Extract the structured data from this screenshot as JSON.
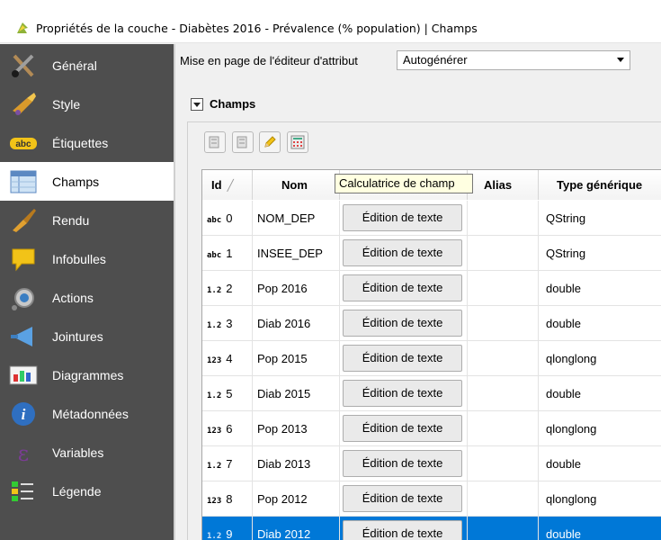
{
  "window": {
    "title": "Propriétés de la couche - Diabètes 2016 - Prévalence (% population) | Champs"
  },
  "sidebar": {
    "items": [
      {
        "label": "Général",
        "icon": "general-tools-icon"
      },
      {
        "label": "Style",
        "icon": "style-brush-icon"
      },
      {
        "label": "Étiquettes",
        "icon": "labels-abc-icon"
      },
      {
        "label": "Champs",
        "icon": "fields-table-icon"
      },
      {
        "label": "Rendu",
        "icon": "rendering-brush-icon"
      },
      {
        "label": "Infobulles",
        "icon": "tooltip-bubble-icon"
      },
      {
        "label": "Actions",
        "icon": "actions-gear-icon"
      },
      {
        "label": "Jointures",
        "icon": "joins-icon"
      },
      {
        "label": "Diagrammes",
        "icon": "diagrams-icon"
      },
      {
        "label": "Métadonnées",
        "icon": "metadata-info-icon"
      },
      {
        "label": "Variables",
        "icon": "variables-epsilon-icon"
      },
      {
        "label": "Légende",
        "icon": "legend-icon"
      }
    ],
    "active": "Champs"
  },
  "editor": {
    "layout_label": "Mise en page de l'éditeur d'attribut",
    "layout_value": "Autogénérer"
  },
  "group": {
    "title": "Champs"
  },
  "tooltip": {
    "text": "Calculatrice de champ"
  },
  "table": {
    "headers": {
      "id": "Id",
      "nom": "Nom",
      "alias": "Alias",
      "type": "Type générique"
    },
    "rows": [
      {
        "badge": "abc",
        "id": "0",
        "nom": "NOM_DEP",
        "edit": "Édition de texte",
        "alias": "",
        "type": "QString"
      },
      {
        "badge": "abc",
        "id": "1",
        "nom": "INSEE_DEP",
        "edit": "Édition de texte",
        "alias": "",
        "type": "QString"
      },
      {
        "badge": "1.2",
        "id": "2",
        "nom": "Pop 2016",
        "edit": "Édition de texte",
        "alias": "",
        "type": "double"
      },
      {
        "badge": "1.2",
        "id": "3",
        "nom": "Diab 2016",
        "edit": "Édition de texte",
        "alias": "",
        "type": "double"
      },
      {
        "badge": "123",
        "id": "4",
        "nom": "Pop 2015",
        "edit": "Édition de texte",
        "alias": "",
        "type": "qlonglong"
      },
      {
        "badge": "1.2",
        "id": "5",
        "nom": "Diab 2015",
        "edit": "Édition de texte",
        "alias": "",
        "type": "double"
      },
      {
        "badge": "123",
        "id": "6",
        "nom": "Pop 2013",
        "edit": "Édition de texte",
        "alias": "",
        "type": "qlonglong"
      },
      {
        "badge": "1.2",
        "id": "7",
        "nom": "Diab 2013",
        "edit": "Édition de texte",
        "alias": "",
        "type": "double"
      },
      {
        "badge": "123",
        "id": "8",
        "nom": "Pop 2012",
        "edit": "Édition de texte",
        "alias": "",
        "type": "qlonglong"
      },
      {
        "badge": "1.2",
        "id": "9",
        "nom": "Diab 2012",
        "edit": "Édition de texte",
        "alias": "",
        "type": "double"
      }
    ],
    "selected_row": 9
  },
  "colors": {
    "sidebar_bg": "#4e4e4e",
    "selection": "#0078d7",
    "tooltip_bg": "#ffffe1"
  }
}
